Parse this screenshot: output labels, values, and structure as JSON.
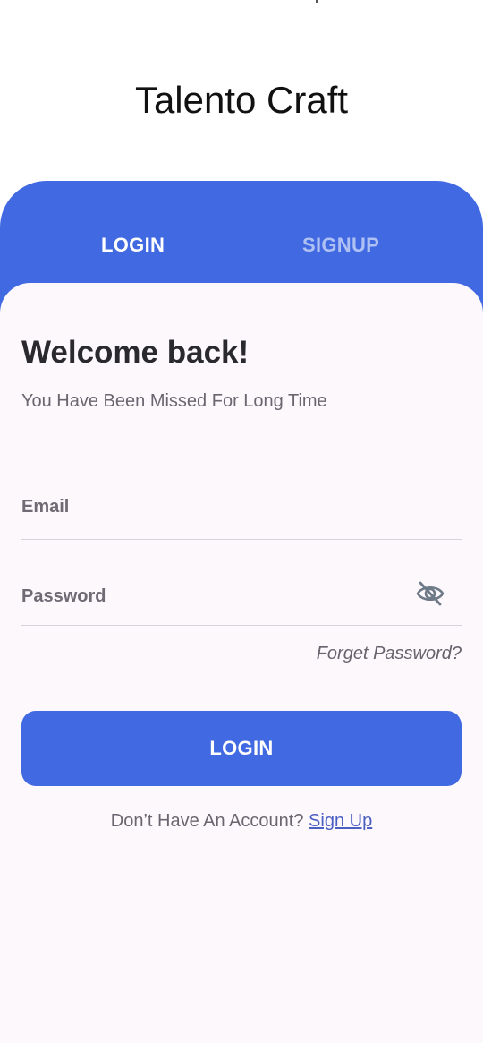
{
  "app": {
    "title": "Talento Craft"
  },
  "tabs": {
    "login_label": "LOGIN",
    "signup_label": "SIGNUP",
    "active": "LOGIN"
  },
  "form": {
    "heading": "Welcome back!",
    "subtitle": "You Have Been Missed For Long Time",
    "email_placeholder": "Email",
    "email_value": "",
    "password_placeholder": "Password",
    "password_value": "",
    "password_toggle_icon": "eye-off-icon",
    "forget_password_label": "Forget Password?",
    "login_button_label": "LOGIN",
    "no_account_text": "Don’t Have An Account?",
    "signup_link_label": "Sign Up"
  },
  "colors": {
    "primary": "#4169E1",
    "card_background": "#FDF8FC",
    "inactive_tab": "#AFC0F3"
  }
}
